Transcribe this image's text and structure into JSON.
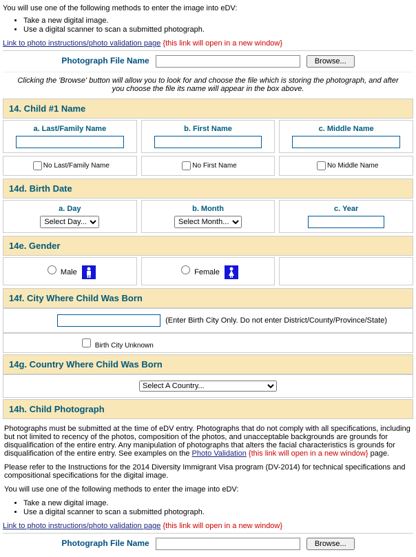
{
  "intro1": "You will use one of the following methods to enter the image into eDV:",
  "bullets": {
    "b1": "Take a new digital image.",
    "b2": "Use a digital scanner to scan a submitted photograph."
  },
  "link_text": "Link to photo instructions/photo validation page",
  "link_note": "{this link will open in a new window}",
  "photo": {
    "label": "Photograph File Name",
    "browse": "Browse..."
  },
  "browse_help": "Clicking the 'Browse' button will allow you to look for and choose the file which is storing the photograph, and after you choose the file its name will appear in the box above.",
  "sec14": {
    "title": "14. Child #1 Name",
    "a": "a. Last/Family Name",
    "b": "b. First Name",
    "c": "c. Middle Name",
    "na": "No Last/Family Name",
    "nb": "No First Name",
    "nc": "No Middle Name"
  },
  "sec14d": {
    "title": "14d. Birth Date",
    "a": "a. Day",
    "b": "b. Month",
    "c": "c. Year",
    "day_sel": "Select Day...",
    "month_sel": "Select Month..."
  },
  "sec14e": {
    "title": "14e. Gender",
    "male": "Male",
    "female": "Female"
  },
  "sec14f": {
    "title": "14f. City Where Child Was Born",
    "help": "(Enter Birth City Only. Do not enter District/County/Province/State)",
    "cb": "Birth City Unknown"
  },
  "sec14g": {
    "title": "14g. Country Where Child Was Born",
    "sel": "Select A Country..."
  },
  "sec14h": {
    "title": "14h. Child Photograph",
    "p1a": "Photographs must be submitted at the time of eDV entry. Photographs that do not comply with all specifications, including but not limited to recency of the photos, composition of the photos, and unacceptable backgrounds are grounds for disqualification of the entire entry. Any manipulation of photographs that alters the facial characteristics is grounds for disqualification of the entire entry. See examples on the ",
    "p1link": "Photo Validation",
    "p1b": " page.",
    "p2": "Please refer to the Instructions for the 2014 Diversity Immigrant Visa program (DV-2014) for technical specifications and compositional specifications for the digital image.",
    "p3": "You will use one of the following methods to enter the image into eDV:"
  }
}
